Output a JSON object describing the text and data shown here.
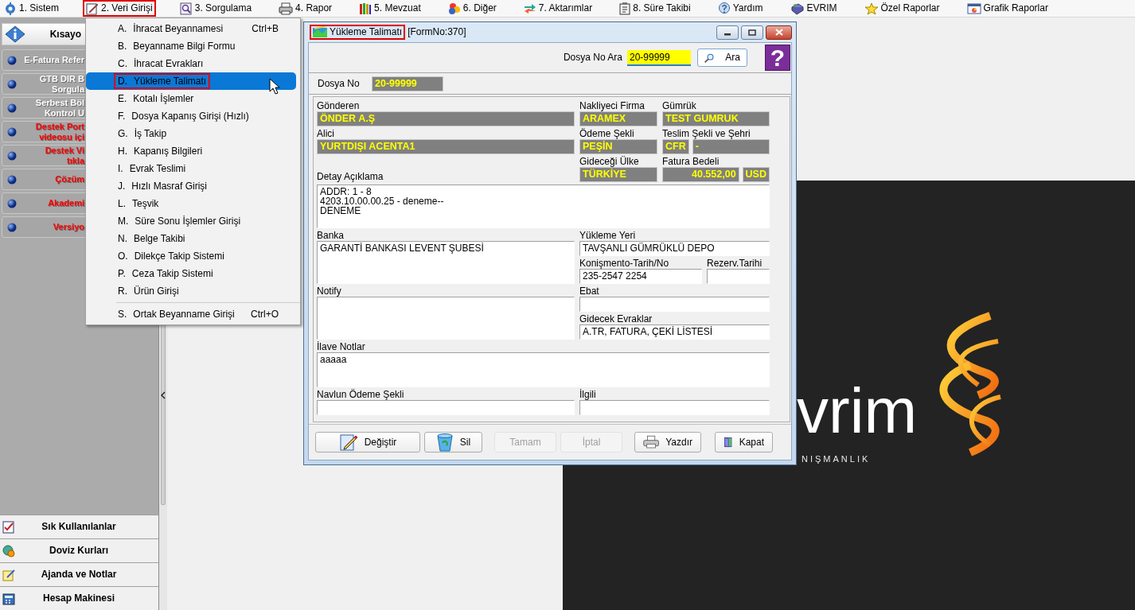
{
  "menu_bar": [
    {
      "label": "1.  Sistem",
      "selected": false
    },
    {
      "label": "2.  Veri Girişi",
      "selected": true
    },
    {
      "label": "3.  Sorgulama",
      "selected": false
    },
    {
      "label": "4.  Rapor",
      "selected": false
    },
    {
      "label": "5.  Mevzuat",
      "selected": false
    },
    {
      "label": "6.  Diğer",
      "selected": false
    },
    {
      "label": "7.  Aktarımlar",
      "selected": false
    },
    {
      "label": "8. Süre Takibi",
      "selected": false
    },
    {
      "label": "Yardım",
      "selected": false
    },
    {
      "label": "EVRIM",
      "selected": false
    },
    {
      "label": "Özel Raporlar",
      "selected": false
    },
    {
      "label": "Grafik Raporlar",
      "selected": false
    }
  ],
  "dropdown": {
    "groups": [
      [
        {
          "letter": "A.",
          "label": "İhracat Beyannamesi",
          "shortcut": "Ctrl+B",
          "selected": false
        },
        {
          "letter": "B.",
          "label": "Beyanname Bilgi Formu",
          "selected": false
        },
        {
          "letter": "C.",
          "label": "İhracat Evrakları",
          "selected": false
        },
        {
          "letter": "D.",
          "label": "Yükleme Talimatı",
          "selected": true
        },
        {
          "letter": "E.",
          "label": "Kotalı İşlemler",
          "selected": false
        },
        {
          "letter": "F.",
          "label": "Dosya Kapanış Girişi (Hızlı)",
          "selected": false
        },
        {
          "letter": "G.",
          "label": "İş Takip",
          "selected": false
        },
        {
          "letter": "H.",
          "label": "Kapanış Bilgileri",
          "selected": false
        },
        {
          "letter": "I.",
          "label": "Evrak Teslimi",
          "selected": false
        },
        {
          "letter": "J.",
          "label": "Hızlı Masraf Girişi",
          "selected": false
        },
        {
          "letter": "L.",
          "label": "Teşvik",
          "selected": false
        },
        {
          "letter": "M.",
          "label": "Süre Sonu İşlemler Girişi",
          "selected": false
        },
        {
          "letter": "N.",
          "label": "Belge Takibi",
          "selected": false
        },
        {
          "letter": "O.",
          "label": "Dilekçe Takip Sistemi",
          "selected": false
        },
        {
          "letter": "P.",
          "label": "Ceza Takip Sistemi",
          "selected": false
        },
        {
          "letter": "R.",
          "label": "Ürün Girişi",
          "selected": false
        }
      ],
      [
        {
          "letter": "S.",
          "label": "Ortak Beyanname Girişi",
          "shortcut": "Ctrl+O",
          "selected": false
        }
      ]
    ]
  },
  "sidebar": {
    "header": "Kısayo",
    "links": [
      {
        "lines": [
          "E-Fatura Refer"
        ],
        "color": "#ffffff"
      },
      {
        "lines": [
          "GTB DIR B",
          "Sorgula"
        ],
        "color": "#ffffff"
      },
      {
        "lines": [
          "Serbest Böl",
          "Kontrol U"
        ],
        "color": "#ffffff"
      },
      {
        "lines": [
          "Destek Port",
          "videosu içi"
        ],
        "color": "#ff0000"
      },
      {
        "lines": [
          "Destek Vi",
          "tıkla"
        ],
        "color": "#ff0000"
      },
      {
        "lines": [
          "Çözüm"
        ],
        "color": "#ff0000"
      },
      {
        "lines": [
          "Akademi"
        ],
        "color": "#ff0000"
      },
      {
        "lines": [
          "Versiyo"
        ],
        "color": "#ff0000"
      }
    ],
    "bottom": [
      {
        "label": "Sık Kullanılanlar"
      },
      {
        "label": "Doviz Kurları"
      },
      {
        "label": "Ajanda ve Notlar"
      },
      {
        "label": "Hesap Makinesi"
      }
    ]
  },
  "wallpaper": {
    "logo_text": "vrim",
    "tagline": "NIŞMANLIK"
  },
  "window": {
    "title": "Yükleme Talimatı",
    "subtitle": "[FormNo:370]",
    "search": {
      "label": "Dosya No Ara",
      "value": "20-99999",
      "button": "Ara",
      "help": "?"
    },
    "file_no": {
      "label": "Dosya No",
      "value": "20-99999"
    },
    "fields": [
      {
        "label": "Gönderen",
        "kind": "readonly",
        "value": "ÖNDER A.Ş"
      },
      {
        "label": "Nakliyeci Firma",
        "kind": "readonly",
        "value": "ARAMEX"
      },
      {
        "label": "Gümrük",
        "kind": "readonly",
        "value": "TEST GUMRUK"
      },
      {
        "label": "Alici",
        "kind": "readonly",
        "value": "YURTDIŞI ACENTA1"
      },
      {
        "label": "Ödeme Şekli",
        "kind": "readonly",
        "value": "PEŞİN"
      },
      {
        "label": "Teslim Şekli ve Şehri",
        "kind": "split",
        "parts": [
          {
            "kind": "readonly",
            "value": "CFR"
          },
          {
            "kind": "readonly",
            "value": "-"
          }
        ]
      },
      {
        "label": "Gideceği Ülke",
        "kind": "readonly",
        "value": "TÜRKİYE"
      },
      {
        "label": "Fatura Bedeli",
        "kind": "split",
        "parts": [
          {
            "kind": "amount",
            "value": "40.552,00"
          },
          {
            "kind": "readonly",
            "value": "USD"
          }
        ]
      },
      {
        "label": "Detay Açıklama",
        "kind": "textarea",
        "value": "ADDR: 1 - 8\n4203.10.00.00.25 - deneme--\nDENEME"
      },
      {
        "label": "Banka",
        "kind": "textarea",
        "value": "GARANTİ BANKASI LEVENT ŞUBESİ"
      },
      {
        "label": "Yükleme Yeri",
        "kind": "text",
        "value": "TAVŞANLI GÜMRÜKLÜ DEPO"
      },
      {
        "label": "Konişmento-Tarih/No",
        "kind": "text",
        "value": "235-2547 2254"
      },
      {
        "label": "Rezerv.Tarihi",
        "kind": "text"
      },
      {
        "label": "Notify",
        "kind": "textarea"
      },
      {
        "label": "Ebat",
        "kind": "text"
      },
      {
        "label": "Gidecek Evraklar",
        "kind": "text",
        "value": "A.TR, FATURA, ÇEKİ LİSTESİ"
      },
      {
        "label": "İlave Notlar",
        "kind": "textarea",
        "value": "aaaaa"
      },
      {
        "label": "Navlun Ödeme Şekli",
        "kind": "text"
      },
      {
        "label": "İlgili",
        "kind": "text"
      }
    ],
    "buttons": [
      {
        "label": "Değiştir",
        "disabled": false
      },
      {
        "label": "Sil",
        "disabled": false
      },
      {
        "label": "Tamam",
        "disabled": true
      },
      {
        "label": "İptal",
        "disabled": true
      },
      {
        "label": "Yazdır",
        "disabled": false
      },
      {
        "label": "Kapat",
        "disabled": false
      }
    ]
  }
}
